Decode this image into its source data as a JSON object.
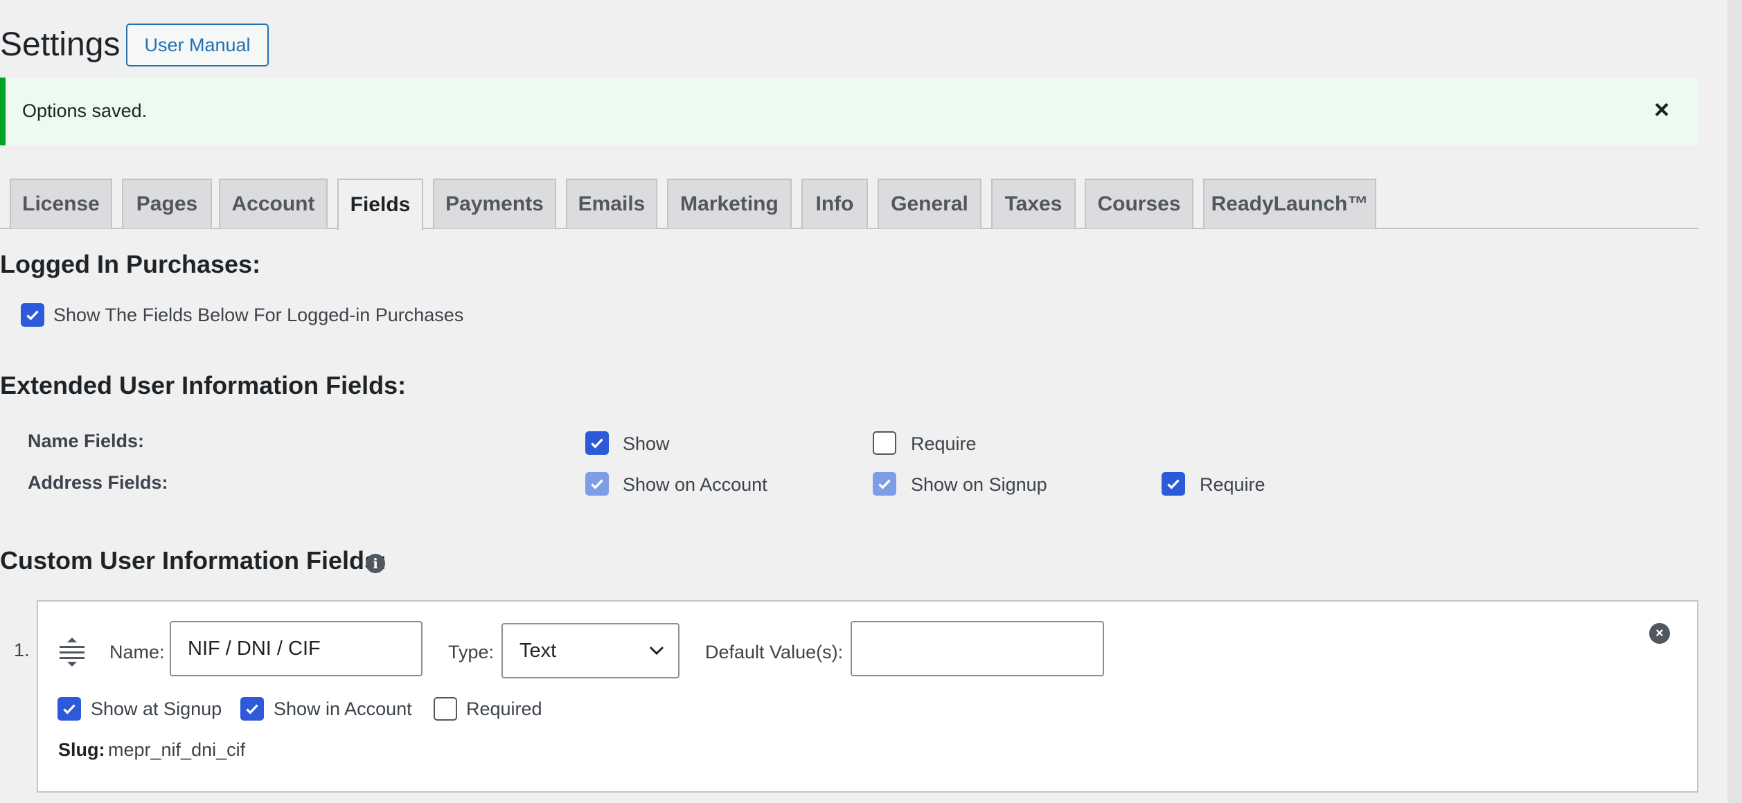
{
  "header": {
    "title": "Settings",
    "manual_button": "User Manual"
  },
  "notice": {
    "text": "Options saved.",
    "close_glyph": "×"
  },
  "tabs": [
    {
      "label": "License"
    },
    {
      "label": "Pages"
    },
    {
      "label": "Account"
    },
    {
      "label": "Fields",
      "active": true
    },
    {
      "label": "Payments"
    },
    {
      "label": "Emails"
    },
    {
      "label": "Marketing"
    },
    {
      "label": "Info"
    },
    {
      "label": "General"
    },
    {
      "label": "Taxes"
    },
    {
      "label": "Courses"
    },
    {
      "label": "ReadyLaunch™"
    }
  ],
  "logged_in": {
    "heading": "Logged In Purchases:",
    "checkbox_label": "Show The Fields Below For Logged-in Purchases",
    "checked": true
  },
  "extended": {
    "heading": "Extended User Information Fields:",
    "name_fields": {
      "label": "Name Fields:",
      "show": "Show",
      "require": "Require"
    },
    "address_fields": {
      "label": "Address Fields:",
      "show_on_account": "Show on Account",
      "show_on_signup": "Show on Signup",
      "require": "Require"
    }
  },
  "custom": {
    "heading": "Custom User Information Fields:",
    "info_glyph": "i",
    "field": {
      "number": "1.",
      "name_label": "Name:",
      "name_value": "NIF / DNI / CIF",
      "type_label": "Type:",
      "type_value": "Text",
      "default_label": "Default Value(s):",
      "default_value": "",
      "show_signup": "Show at Signup",
      "show_account": "Show in Account",
      "required": "Required",
      "slug_label": "Slug:",
      "slug_value": "mepr_nif_dni_cif",
      "remove_glyph": "×"
    }
  },
  "colors": {
    "accent": "#2c5ad8",
    "notice_border": "#00a32a",
    "notice_bg": "#edfaef"
  }
}
